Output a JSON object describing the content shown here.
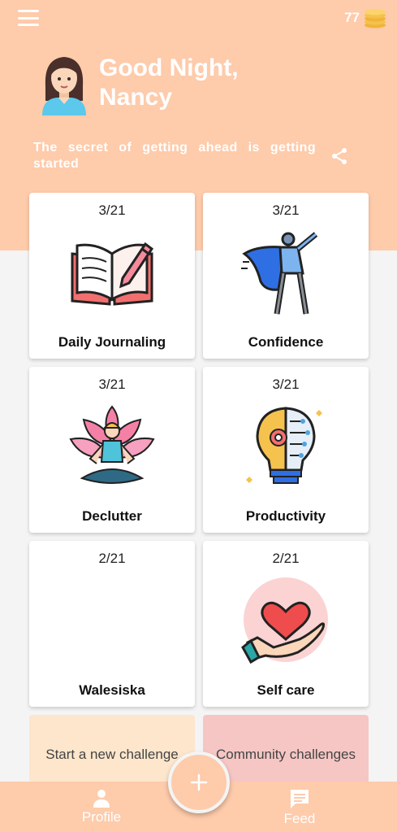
{
  "header": {
    "coin_count": "77",
    "greeting_line1": "Good Night,",
    "greeting_line2": "Nancy",
    "quote": "The secret of getting ahead is getting started"
  },
  "challenges": [
    {
      "progress": "3/21",
      "title": "Daily Journaling",
      "icon": "journal-book-icon"
    },
    {
      "progress": "3/21",
      "title": "Confidence",
      "icon": "superhero-icon"
    },
    {
      "progress": "3/21",
      "title": "Declutter",
      "icon": "meditation-lotus-icon"
    },
    {
      "progress": "3/21",
      "title": "Productivity",
      "icon": "lightbulb-brain-icon"
    },
    {
      "progress": "2/21",
      "title": "Walesiska",
      "icon": ""
    },
    {
      "progress": "2/21",
      "title": "Self care",
      "icon": "heart-hand-icon"
    }
  ],
  "actions": {
    "new_challenge": "Start a new challenge",
    "community": "Community challenges"
  },
  "nav": {
    "profile_label": "Profile",
    "feed_label": "Feed"
  },
  "colors": {
    "accent": "#fecbab",
    "background": "#f4f4f4",
    "new_challenge_bg": "#fde6cc",
    "community_bg": "#f5c6c4"
  }
}
